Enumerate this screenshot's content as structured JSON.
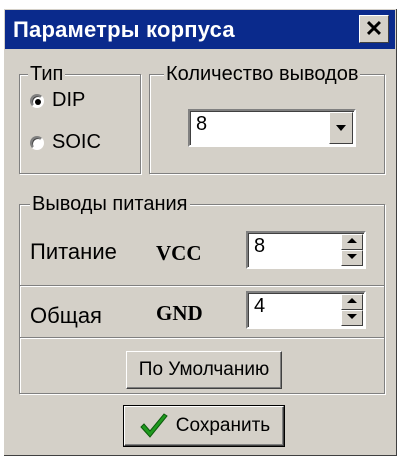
{
  "window": {
    "title": "Параметры корпуса",
    "close_symbol": "✕"
  },
  "type_group": {
    "label": "Тип",
    "options": [
      {
        "label": "DIP",
        "checked": true
      },
      {
        "label": "SOIC",
        "checked": false
      }
    ]
  },
  "pins_group": {
    "label": "Количество выводов",
    "selected_value": "8"
  },
  "power_group": {
    "label": "Выводы питания",
    "vcc": {
      "label": "Питание",
      "pin_name": "VCC",
      "value": "8"
    },
    "gnd": {
      "label": "Общая",
      "pin_name": "GND",
      "value": "4"
    },
    "default_button": "По Умолчанию"
  },
  "save_button": {
    "label": "Сохранить",
    "icon": "checkmark-icon"
  },
  "colors": {
    "titlebar": "#0a2a8c",
    "face": "#d4d0c8",
    "check_green": "#1f9a1f"
  }
}
